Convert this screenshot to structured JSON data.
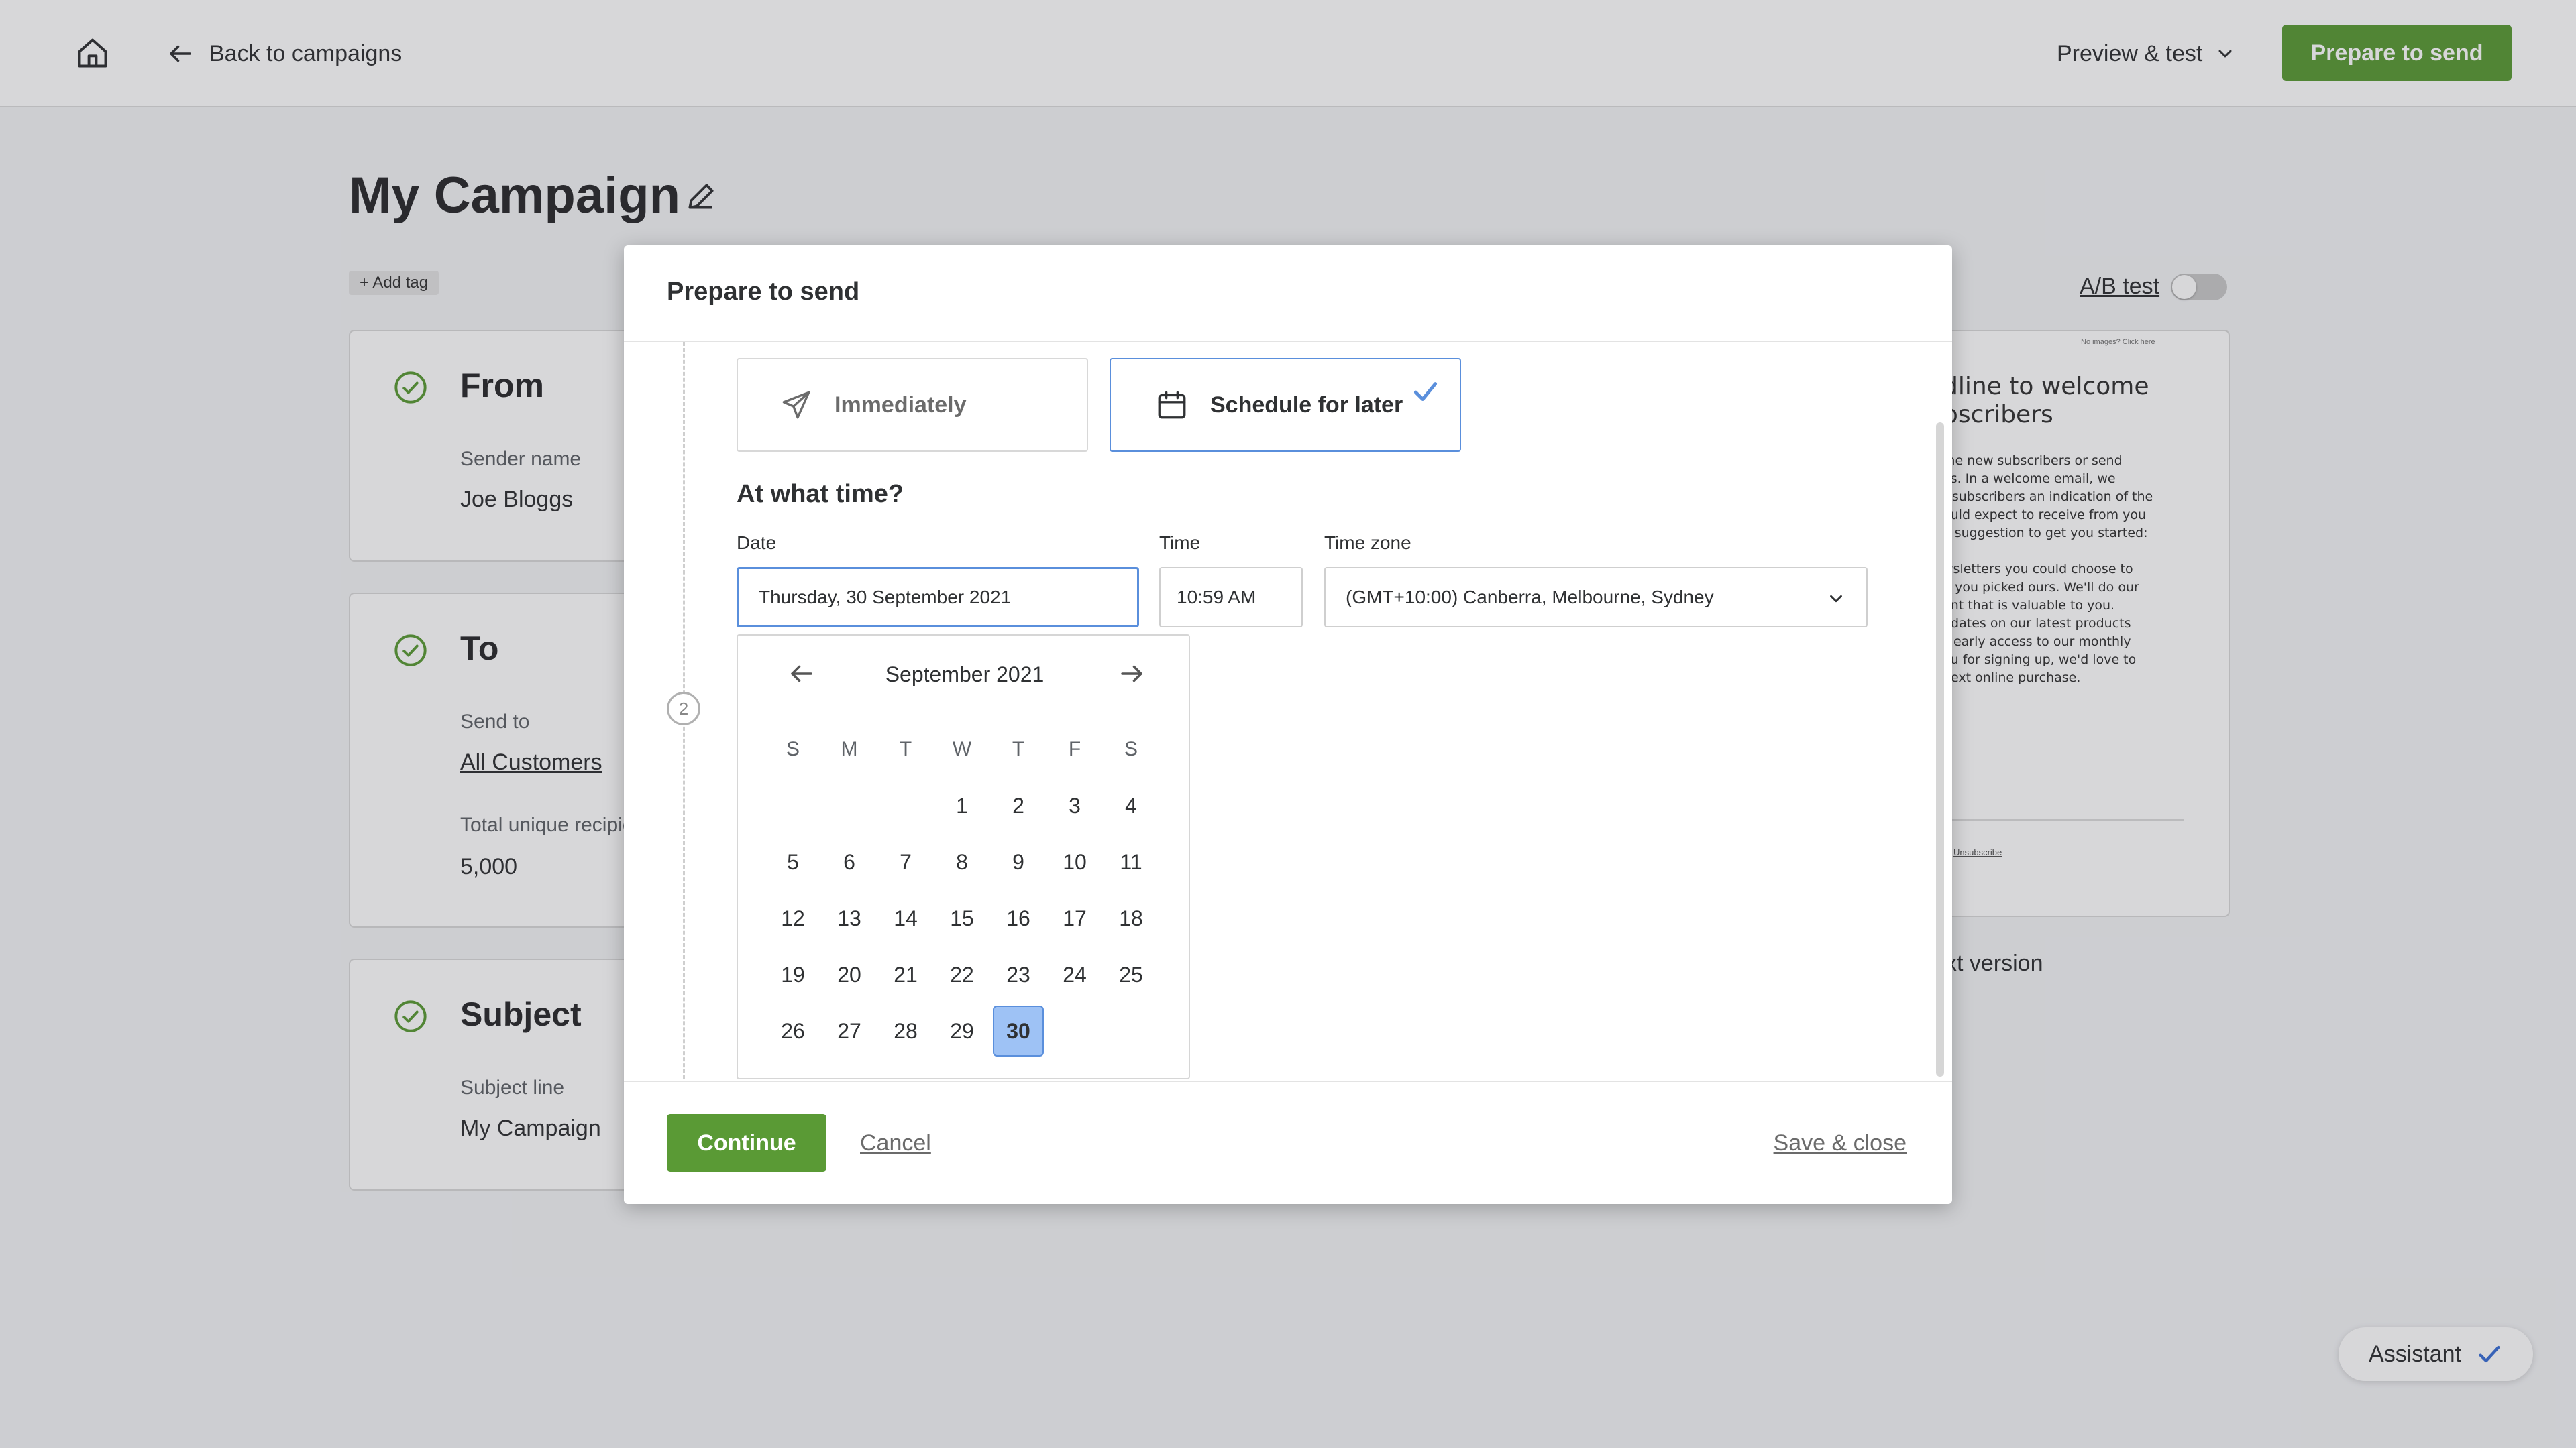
{
  "topbar": {
    "back_label": "Back to campaigns",
    "preview_label": "Preview & test",
    "prepare_label": "Prepare to send"
  },
  "campaign": {
    "title": "My Campaign",
    "add_tag": "+ Add tag",
    "ab_test_label": "A/B test"
  },
  "cards": {
    "from": {
      "title": "From",
      "label": "Sender name",
      "value": "Joe Bloggs"
    },
    "to": {
      "title": "To",
      "label": "Send to",
      "value": "All Customers",
      "label2": "Total unique recipie",
      "value2": "5,000"
    },
    "subject": {
      "title": "Subject",
      "label": "Subject line",
      "value": "My Campaign"
    }
  },
  "email_preview": {
    "small_note": "No images? Click here",
    "headline": "dline to welcome\nbscribers",
    "body": "me new subscribers or send\nes. In a welcome email, we\nr subscribers an indication of the\nould expect to receive from you\na suggestion to get you started:\n\nwsletters you could choose to\nd you picked ours. We'll do our\nent that is valuable to you.\npdates on our latest products\ns early access to our monthly\nou for signing up, we'd love to\nnext online purchase.",
    "unsubscribe": "Unsubscribe",
    "text_version": "xt version"
  },
  "assistant_label": "Assistant",
  "modal": {
    "title": "Prepare to send",
    "step_number": "2",
    "option_immediately": "Immediately",
    "option_schedule": "Schedule for later",
    "section_heading": "At what time?",
    "date_label": "Date",
    "date_value": "Thursday, 30 September 2021",
    "time_label": "Time",
    "time_value": "10:59 AM",
    "timezone_label": "Time zone",
    "timezone_value": "(GMT+10:00) Canberra, Melbourne, Sydney",
    "calendar": {
      "month_label": "September 2021",
      "weekdays": [
        "S",
        "M",
        "T",
        "W",
        "T",
        "F",
        "S"
      ],
      "leading_blanks": 3,
      "days": [
        "1",
        "2",
        "3",
        "4",
        "5",
        "6",
        "7",
        "8",
        "9",
        "10",
        "11",
        "12",
        "13",
        "14",
        "15",
        "16",
        "17",
        "18",
        "19",
        "20",
        "21",
        "22",
        "23",
        "24",
        "25",
        "26",
        "27",
        "28",
        "29",
        "30"
      ],
      "selected_day": "30"
    },
    "continue_label": "Continue",
    "cancel_label": "Cancel",
    "save_close_label": "Save & close"
  },
  "colors": {
    "brand_green": "#5a9a35",
    "accent_blue": "#5a8fdc",
    "selected_day_bg": "#9ec2f5"
  }
}
